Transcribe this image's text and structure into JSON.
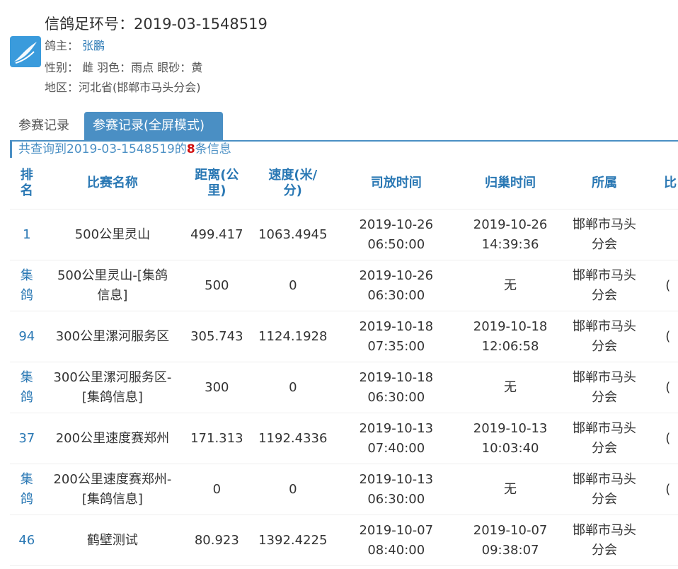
{
  "header": {
    "title": "信鸽足环号：2019-03-1548519",
    "owner_label": "鸽主：",
    "owner_name": "张鹏",
    "attributes": "性别： 雌 羽色：雨点 眼砂：黄",
    "region": "地区：河北省(邯郸市马头分会)"
  },
  "tabs": [
    {
      "label": "参赛记录"
    },
    {
      "label": "参赛记录(全屏模式)"
    }
  ],
  "summary": {
    "prefix": "共查询到2019-03-1548519的",
    "count": "8",
    "suffix": "条信息"
  },
  "table": {
    "columns": [
      "排名",
      "比赛名称",
      "距离(公里)",
      "速度(米/分)",
      "司放时间",
      "归巢时间",
      "所属",
      "比"
    ],
    "rows": [
      {
        "rank": "1",
        "race": "500公里灵山",
        "distance": "499.417",
        "speed": "1063.4945",
        "release_date": "2019-10-26",
        "release_time": "06:50:00",
        "return_date": "2019-10-26",
        "return_time": "14:39:36",
        "return_none": "",
        "org": "邯郸市马头分会",
        "extra": ""
      },
      {
        "rank": "集鸽",
        "race": "500公里灵山-[集鸽信息]",
        "distance": "500",
        "speed": "0",
        "release_date": "2019-10-26",
        "release_time": "06:30:00",
        "return_date": "",
        "return_time": "",
        "return_none": "无",
        "org": "邯郸市马头分会",
        "extra": "("
      },
      {
        "rank": "94",
        "race": "300公里漯河服务区",
        "distance": "305.743",
        "speed": "1124.1928",
        "release_date": "2019-10-18",
        "release_time": "07:35:00",
        "return_date": "2019-10-18",
        "return_time": "12:06:58",
        "return_none": "",
        "org": "邯郸市马头分会",
        "extra": "("
      },
      {
        "rank": "集鸽",
        "race": "300公里漯河服务区-[集鸽信息]",
        "distance": "300",
        "speed": "0",
        "release_date": "2019-10-18",
        "release_time": "06:30:00",
        "return_date": "",
        "return_time": "",
        "return_none": "无",
        "org": "邯郸市马头分会",
        "extra": "("
      },
      {
        "rank": "37",
        "race": "200公里速度赛郑州",
        "distance": "171.313",
        "speed": "1192.4336",
        "release_date": "2019-10-13",
        "release_time": "07:40:00",
        "return_date": "2019-10-13",
        "return_time": "10:03:40",
        "return_none": "",
        "org": "邯郸市马头分会",
        "extra": "("
      },
      {
        "rank": "集鸽",
        "race": "200公里速度赛郑州-[集鸽信息]",
        "distance": "0",
        "speed": "0",
        "release_date": "2019-10-13",
        "release_time": "06:30:00",
        "return_date": "",
        "return_time": "",
        "return_none": "无",
        "org": "邯郸市马头分会",
        "extra": "("
      },
      {
        "rank": "46",
        "race": "鹤壁测试",
        "distance": "80.923",
        "speed": "1392.4225",
        "release_date": "2019-10-07",
        "release_time": "08:40:00",
        "return_date": "2019-10-07",
        "return_time": "09:38:07",
        "return_none": "",
        "org": "邯郸市马头分会",
        "extra": ""
      }
    ]
  },
  "colors": {
    "accent": "#4a8fc4",
    "link": "#2a78b4",
    "highlight": "#d01010",
    "logo": "#3a9bdc"
  },
  "icons": {
    "logo": "pigeon-feather-icon"
  }
}
